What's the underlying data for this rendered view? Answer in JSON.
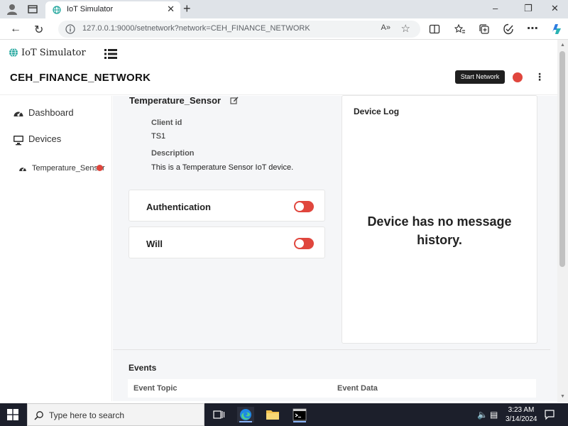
{
  "browser": {
    "tab_title": "IoT Simulator",
    "url": "127.0.0.1:9000/setnetwork?network=CEH_FINANCE_NETWORK",
    "reader_label": "A»",
    "close_tab_glyph": "✕",
    "new_tab_glyph": "+",
    "min_glyph": "–",
    "max_glyph": "❐",
    "close_glyph": "✕"
  },
  "app": {
    "brand": "IoT Simulator",
    "network_name": "CEH_FINANCE_NETWORK",
    "start_network_label": "Start Network",
    "kebab_glyph": "⋮",
    "status_color": "#e0463d"
  },
  "sidebar": {
    "items": [
      {
        "label": "Dashboard",
        "icon": "gauge-icon"
      },
      {
        "label": "Devices",
        "icon": "monitor-icon"
      }
    ],
    "devices": [
      {
        "label": "Temperature_Sensor",
        "icon": "gauge-icon",
        "status_color": "#e0463d"
      }
    ]
  },
  "device": {
    "name": "Temperature_Sensor",
    "client_id_label": "Client id",
    "client_id": "TS1",
    "description_label": "Description",
    "description": "This is a Temperature Sensor IoT device.",
    "authentication_label": "Authentication",
    "authentication_enabled": false,
    "will_label": "Will",
    "will_enabled": false
  },
  "device_log": {
    "title": "Device Log",
    "empty_message": "Device has no message history."
  },
  "events": {
    "title": "Events",
    "columns": [
      "Event Topic",
      "Event Data"
    ]
  },
  "taskbar": {
    "search_placeholder": "Type here to search",
    "time": "3:23 AM",
    "date": "3/14/2024"
  }
}
